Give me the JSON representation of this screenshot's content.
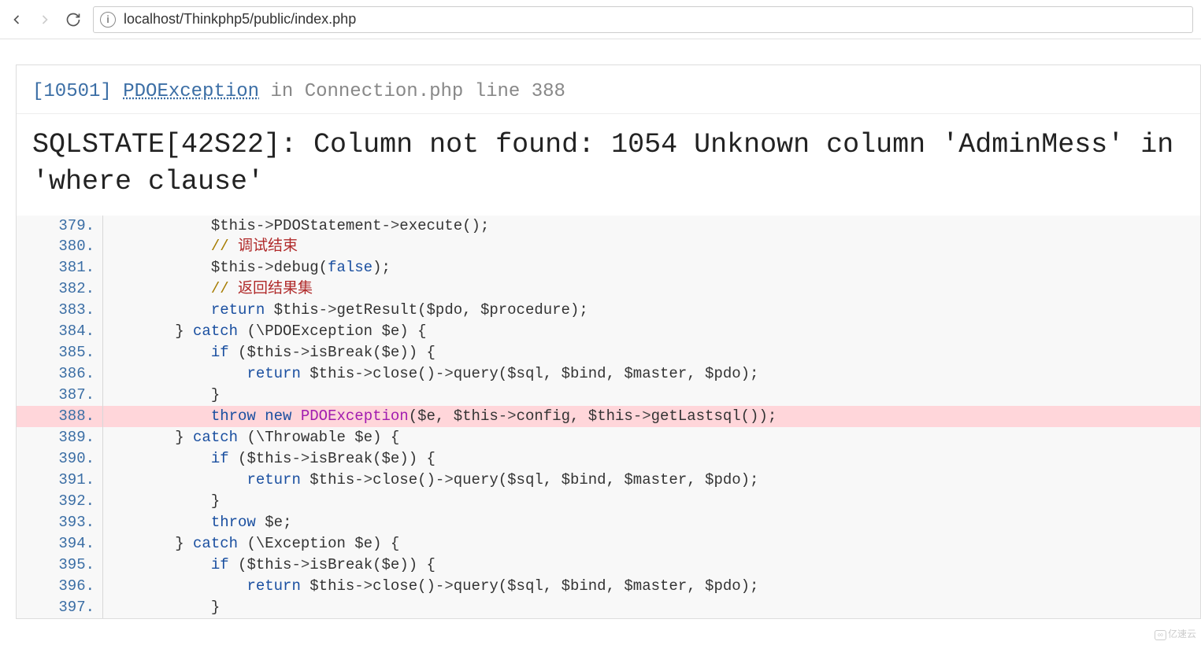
{
  "browser": {
    "url": "localhost/Thinkphp5/public/index.php"
  },
  "error": {
    "code": "[10501]",
    "exception": "PDOException",
    "in": "in",
    "file": "Connection.php line 388",
    "title": "SQLSTATE[42S22]: Column not found: 1054 Unknown column 'AdminMess' in 'where clause'"
  },
  "code": {
    "lines": [
      {
        "n": "379.",
        "html": "            <span class='v'>$this</span><span class='arrow'>-></span><span class='fn'>PDOStatement</span><span class='arrow'>-></span><span class='fn'>execute</span>();"
      },
      {
        "n": "380.",
        "html": "            <span class='cmt'>//</span> <span class='cmt-zh'>调试结束</span>"
      },
      {
        "n": "381.",
        "html": "            <span class='v'>$this</span><span class='arrow'>-></span><span class='fn'>debug</span>(<span class='const'>false</span>);"
      },
      {
        "n": "382.",
        "html": "            <span class='cmt'>//</span> <span class='cmt-zh'>返回结果集</span>"
      },
      {
        "n": "383.",
        "html": "            <span class='k'>return</span> <span class='v'>$this</span><span class='arrow'>-></span><span class='fn'>getResult</span>(<span class='v'>$pdo</span>, <span class='v'>$procedure</span>);"
      },
      {
        "n": "384.",
        "html": "        } <span class='k'>catch</span> (\\PDOException <span class='v'>$e</span>) {"
      },
      {
        "n": "385.",
        "html": "            <span class='k'>if</span> (<span class='v'>$this</span><span class='arrow'>-></span><span class='fn'>isBreak</span>(<span class='v'>$e</span>)) {"
      },
      {
        "n": "386.",
        "html": "                <span class='k'>return</span> <span class='v'>$this</span><span class='arrow'>-></span><span class='fn'>close</span>()<span class='arrow'>-></span><span class='fn'>query</span>(<span class='v'>$sql</span>, <span class='v'>$bind</span>, <span class='v'>$master</span>, <span class='v'>$pdo</span>);"
      },
      {
        "n": "387.",
        "html": "            }"
      },
      {
        "n": "388.",
        "html": "            <span class='k'>throw</span> <span class='k'>new</span> <span class='cls'>PDOException</span>(<span class='v'>$e</span>, <span class='v'>$this</span><span class='arrow'>-></span><span class='fn'>config</span>, <span class='v'>$this</span><span class='arrow'>-></span><span class='fn'>getLastsql</span>());",
        "hl": true
      },
      {
        "n": "389.",
        "html": "        } <span class='k'>catch</span> (\\Throwable <span class='v'>$e</span>) {"
      },
      {
        "n": "390.",
        "html": "            <span class='k'>if</span> (<span class='v'>$this</span><span class='arrow'>-></span><span class='fn'>isBreak</span>(<span class='v'>$e</span>)) {"
      },
      {
        "n": "391.",
        "html": "                <span class='k'>return</span> <span class='v'>$this</span><span class='arrow'>-></span><span class='fn'>close</span>()<span class='arrow'>-></span><span class='fn'>query</span>(<span class='v'>$sql</span>, <span class='v'>$bind</span>, <span class='v'>$master</span>, <span class='v'>$pdo</span>);"
      },
      {
        "n": "392.",
        "html": "            }"
      },
      {
        "n": "393.",
        "html": "            <span class='k'>throw</span> <span class='v'>$e</span>;"
      },
      {
        "n": "394.",
        "html": "        } <span class='k'>catch</span> (\\Exception <span class='v'>$e</span>) {"
      },
      {
        "n": "395.",
        "html": "            <span class='k'>if</span> (<span class='v'>$this</span><span class='arrow'>-></span><span class='fn'>isBreak</span>(<span class='v'>$e</span>)) {"
      },
      {
        "n": "396.",
        "html": "                <span class='k'>return</span> <span class='v'>$this</span><span class='arrow'>-></span><span class='fn'>close</span>()<span class='arrow'>-></span><span class='fn'>query</span>(<span class='v'>$sql</span>, <span class='v'>$bind</span>, <span class='v'>$master</span>, <span class='v'>$pdo</span>);"
      },
      {
        "n": "397.",
        "html": "            }"
      }
    ]
  },
  "watermark": "亿速云"
}
